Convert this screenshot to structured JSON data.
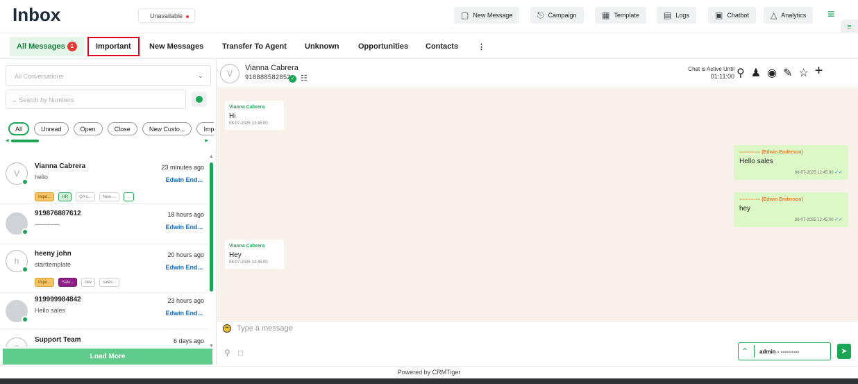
{
  "header": {
    "title": "Inbox",
    "status": "Unavailable",
    "buttons": [
      {
        "label": "New Message",
        "icon": "message-icon"
      },
      {
        "label": "Campaign",
        "icon": "megaphone-icon"
      },
      {
        "label": "Template",
        "icon": "template-icon"
      },
      {
        "label": "Logs",
        "icon": "logs-icon"
      },
      {
        "label": "Chatbot",
        "icon": "chatbot-icon"
      },
      {
        "label": "Analytics",
        "icon": "analytics-icon"
      }
    ]
  },
  "tabs": [
    {
      "label": "All Messages",
      "badge": "1"
    },
    {
      "label": "Important"
    },
    {
      "label": "New Messages"
    },
    {
      "label": "Transfer To Agent"
    },
    {
      "label": "Unknown"
    },
    {
      "label": "Opportunities"
    },
    {
      "label": "Contacts"
    }
  ],
  "sidebar": {
    "conversation_select": "All Conversations",
    "number_search_placeholder": "Search by Numbers",
    "filters": [
      "All",
      "Unread",
      "Open",
      "Close",
      "New Custo...",
      "Importar"
    ],
    "conversations": [
      {
        "name": "Vianna Cabrera",
        "avatar_letter": "V",
        "message": "hello",
        "time": "23 minutes ago",
        "agent": "Edwin End...",
        "tags": [
          {
            "label": "Impo...",
            "style": "orange"
          },
          {
            "label": "HR",
            "style": "green"
          },
          {
            "label": "QA c...",
            "style": "gray"
          },
          {
            "label": "New ...",
            "style": "gray"
          },
          {
            "label": "...",
            "style": "more"
          }
        ]
      },
      {
        "name": "919876887612",
        "message": "------------",
        "time": "18 hours ago",
        "agent": "Edwin End..."
      },
      {
        "name": "heeny john",
        "avatar_letter": "h",
        "message": "starttemplate",
        "time": "20 hours ago",
        "agent": "Edwin End...",
        "tags": [
          {
            "label": "Impo...",
            "style": "orange"
          },
          {
            "label": "Sale...",
            "style": "purple"
          },
          {
            "label": "dev",
            "style": "gray"
          },
          {
            "label": "sales...",
            "style": "gray"
          }
        ]
      },
      {
        "name": "919999984842",
        "message": "Hello sales",
        "time": "23 hours ago",
        "agent": "Edwin End..."
      },
      {
        "name": "Support Team",
        "avatar_letter": "S",
        "time": "6 days ago"
      }
    ],
    "load_more": "Load More"
  },
  "chat": {
    "contact_name": "Vianna Cabrera",
    "contact_avatar_letter": "V",
    "contact_phone": "918888582852",
    "active_label": "Chat is Active Until",
    "active_time": "01:11:00",
    "messages": [
      {
        "direction": "in",
        "sender": "Vianna Cabrera",
        "text": "Hi",
        "time": "08-07-2025 12:45:00"
      },
      {
        "direction": "out",
        "sender": "(Edwin Enderson)",
        "sender_masked": "-------------",
        "text": "Hello sales",
        "time": "08-07-2025 12:45:00"
      },
      {
        "direction": "out",
        "sender": "(Edwin Enderson)",
        "sender_masked": "-------------",
        "text": "hey",
        "time": "08-07-2025 12:45:00"
      },
      {
        "direction": "in",
        "sender": "Vianna Cabrera",
        "text": "Hey",
        "time": "08-07-2025 12:45:00"
      }
    ],
    "composer_placeholder": "Type a message",
    "agent_selector": "admin - ----------"
  },
  "footer": "Powered by CRMTiger",
  "colors": {
    "accent": "#1aa655",
    "tab_highlight": "#e0001b",
    "badge": "#e53935",
    "agent_link": "#1b6ec2"
  }
}
